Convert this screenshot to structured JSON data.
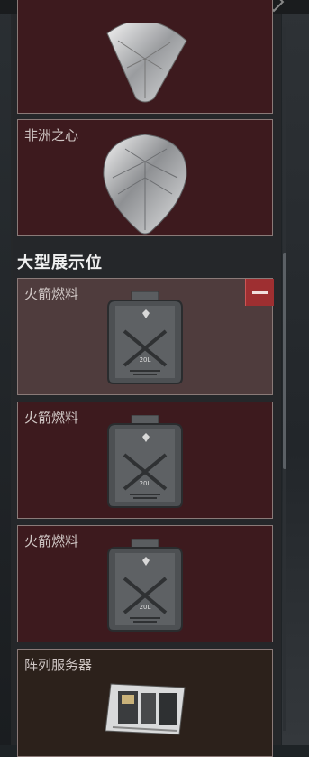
{
  "topbar": {
    "title": "",
    "value": ""
  },
  "section_large": "大型展示位",
  "cards": [
    {
      "label": "",
      "icon": "diamond-icon"
    },
    {
      "label": "非洲之心",
      "icon": "diamond-icon"
    },
    {
      "label": "火箭燃料",
      "icon": "fuel-canister-icon"
    },
    {
      "label": "火箭燃料",
      "icon": "fuel-canister-icon"
    },
    {
      "label": "火箭燃料",
      "icon": "fuel-canister-icon"
    },
    {
      "label": "阵列服务器",
      "icon": "server-icon"
    }
  ],
  "canister_text": "20L"
}
